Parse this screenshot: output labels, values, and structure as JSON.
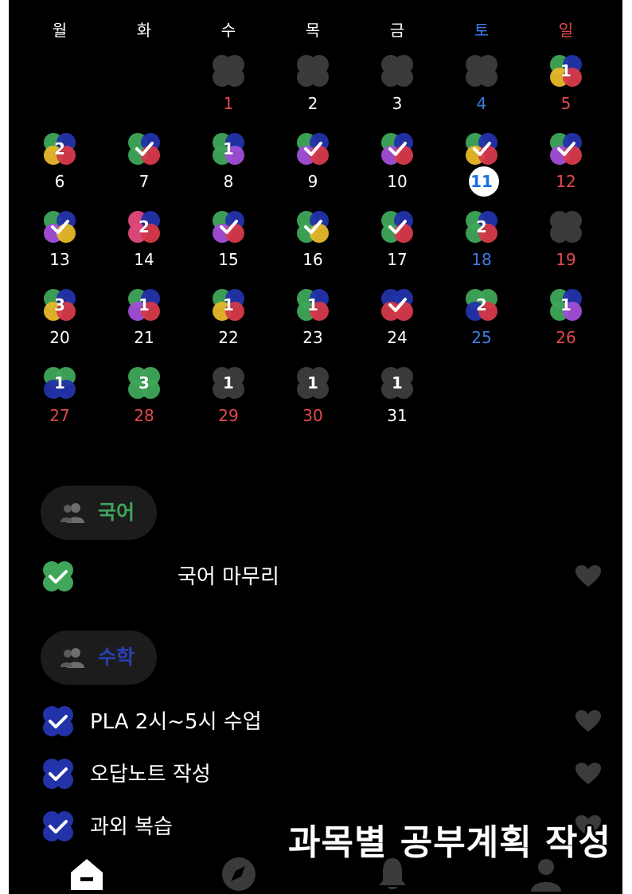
{
  "weekdays": [
    {
      "label": "월",
      "color": "#ffffff"
    },
    {
      "label": "화",
      "color": "#ffffff"
    },
    {
      "label": "수",
      "color": "#ffffff"
    },
    {
      "label": "목",
      "color": "#ffffff"
    },
    {
      "label": "금",
      "color": "#ffffff"
    },
    {
      "label": "토",
      "color": "#3d7ce6"
    },
    {
      "label": "일",
      "color": "#e5484d"
    }
  ],
  "calendar": {
    "today": "11",
    "days": [
      {
        "day": "1",
        "col": 2,
        "row": 0,
        "clover": "empty",
        "mark": "",
        "numColor": "#e5484d"
      },
      {
        "day": "2",
        "col": 3,
        "row": 0,
        "clover": "empty",
        "mark": "",
        "numColor": "#ffffff"
      },
      {
        "day": "3",
        "col": 4,
        "row": 0,
        "clover": "empty",
        "mark": "",
        "numColor": "#ffffff"
      },
      {
        "day": "4",
        "col": 5,
        "row": 0,
        "clover": "empty",
        "mark": "",
        "numColor": "#3d7ce6"
      },
      {
        "day": "5",
        "col": 6,
        "row": 0,
        "clover": "multi4",
        "mark": "1",
        "numColor": "#e5484d"
      },
      {
        "day": "6",
        "col": 0,
        "row": 1,
        "clover": "multi4",
        "mark": "2",
        "numColor": "#ffffff"
      },
      {
        "day": "7",
        "col": 1,
        "row": 1,
        "clover": "multi3",
        "mark": "check",
        "numColor": "#ffffff"
      },
      {
        "day": "8",
        "col": 2,
        "row": 1,
        "clover": "multi3p",
        "mark": "1",
        "numColor": "#ffffff"
      },
      {
        "day": "9",
        "col": 3,
        "row": 1,
        "clover": "multi4p",
        "mark": "check",
        "numColor": "#ffffff"
      },
      {
        "day": "10",
        "col": 4,
        "row": 1,
        "clover": "multi4p",
        "mark": "check",
        "numColor": "#ffffff"
      },
      {
        "day": "11",
        "col": 5,
        "row": 1,
        "clover": "multi4",
        "mark": "check",
        "numColor": "#1a6fe0"
      },
      {
        "day": "12",
        "col": 6,
        "row": 1,
        "clover": "multi4p",
        "mark": "check",
        "numColor": "#e5484d"
      },
      {
        "day": "13",
        "col": 0,
        "row": 2,
        "clover": "multi4py",
        "mark": "check",
        "numColor": "#ffffff"
      },
      {
        "day": "14",
        "col": 1,
        "row": 2,
        "clover": "multi4pk",
        "mark": "2",
        "numColor": "#ffffff"
      },
      {
        "day": "15",
        "col": 2,
        "row": 2,
        "clover": "multi4p",
        "mark": "check",
        "numColor": "#ffffff"
      },
      {
        "day": "16",
        "col": 3,
        "row": 2,
        "clover": "multi4gy",
        "mark": "check",
        "numColor": "#ffffff"
      },
      {
        "day": "17",
        "col": 4,
        "row": 2,
        "clover": "multi3",
        "mark": "check",
        "numColor": "#ffffff"
      },
      {
        "day": "18",
        "col": 5,
        "row": 2,
        "clover": "multi3",
        "mark": "2",
        "numColor": "#3d7ce6"
      },
      {
        "day": "19",
        "col": 6,
        "row": 2,
        "clover": "empty",
        "mark": "",
        "numColor": "#e5484d"
      },
      {
        "day": "20",
        "col": 0,
        "row": 3,
        "clover": "multi4",
        "mark": "3",
        "numColor": "#ffffff"
      },
      {
        "day": "21",
        "col": 1,
        "row": 3,
        "clover": "multi4p",
        "mark": "1",
        "numColor": "#ffffff"
      },
      {
        "day": "22",
        "col": 2,
        "row": 3,
        "clover": "multi4",
        "mark": "1",
        "numColor": "#ffffff"
      },
      {
        "day": "23",
        "col": 3,
        "row": 3,
        "clover": "multi3",
        "mark": "1",
        "numColor": "#ffffff"
      },
      {
        "day": "24",
        "col": 4,
        "row": 3,
        "clover": "blueRed",
        "mark": "check",
        "numColor": "#ffffff"
      },
      {
        "day": "25",
        "col": 5,
        "row": 3,
        "clover": "greenBlue",
        "mark": "2",
        "numColor": "#3d7ce6"
      },
      {
        "day": "26",
        "col": 6,
        "row": 3,
        "clover": "greenP",
        "mark": "1",
        "numColor": "#e5484d"
      },
      {
        "day": "27",
        "col": 0,
        "row": 4,
        "clover": "greenBlue2",
        "mark": "1",
        "numColor": "#e5484d"
      },
      {
        "day": "28",
        "col": 1,
        "row": 4,
        "clover": "green",
        "mark": "3",
        "numColor": "#e5484d"
      },
      {
        "day": "29",
        "col": 2,
        "row": 4,
        "clover": "gray",
        "mark": "1",
        "numColor": "#e5484d"
      },
      {
        "day": "30",
        "col": 3,
        "row": 4,
        "clover": "gray",
        "mark": "1",
        "numColor": "#e5484d"
      },
      {
        "day": "31",
        "col": 4,
        "row": 4,
        "clover": "gray",
        "mark": "1",
        "numColor": "#ffffff"
      }
    ]
  },
  "sections": [
    {
      "label": "국어",
      "color": "#3fa65a",
      "tasks": [
        {
          "label": "국어 마무리",
          "checkColor": "#3fa65a"
        }
      ]
    },
    {
      "label": "수학",
      "color": "#2233aa",
      "tasks": [
        {
          "label": "PLA 2시~5시 수업",
          "checkColor": "#2233aa"
        },
        {
          "label": "오답노트 작성",
          "checkColor": "#2233aa"
        },
        {
          "label": "과외 복습",
          "checkColor": "#2233aa"
        }
      ]
    }
  ],
  "caption": "과목별 공부계획 작성",
  "nav": [
    {
      "name": "home-icon"
    },
    {
      "name": "compass-icon"
    },
    {
      "name": "bell-icon"
    },
    {
      "name": "profile-icon"
    }
  ],
  "colors": {
    "green": "#3fa65a",
    "blue": "#2233aa",
    "red": "#d63a4a",
    "yellow": "#e7b92a",
    "purple": "#a24fd8",
    "pink": "#e24a7c",
    "emptyClover": "#3a3a3a",
    "heart": "#3b3b3b"
  }
}
